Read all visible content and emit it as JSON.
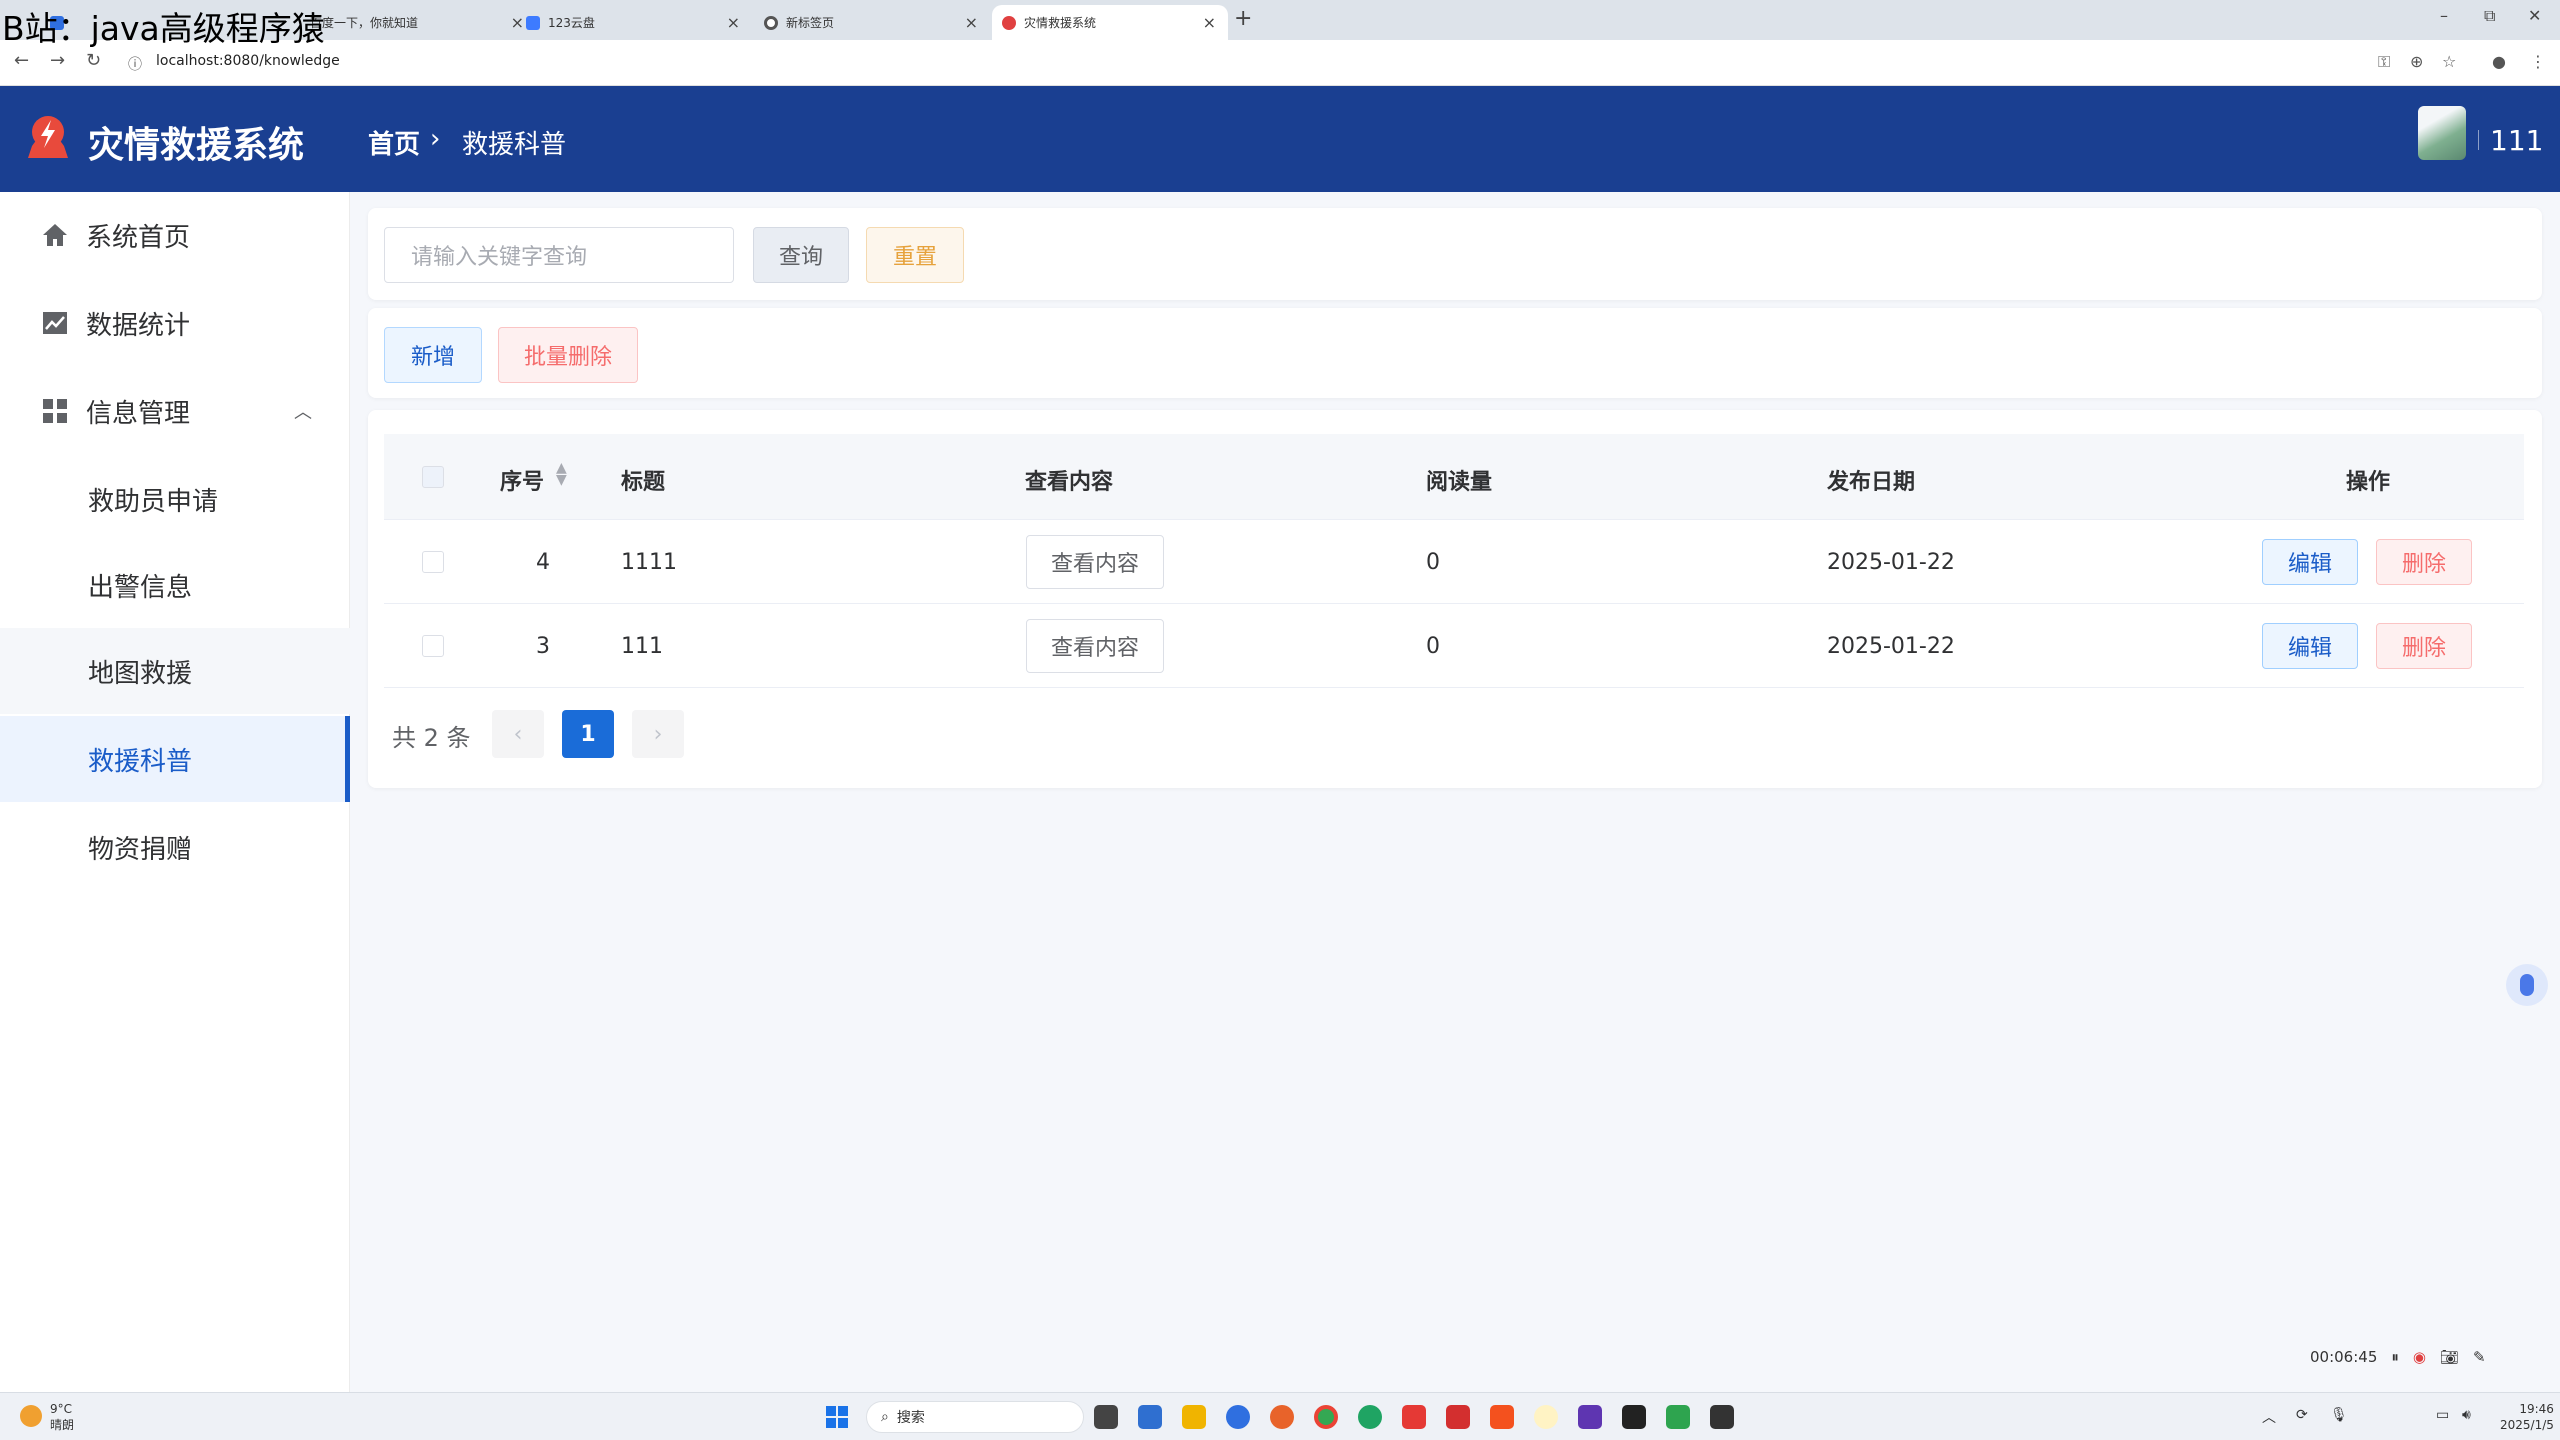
{
  "watermark": "B站：java高级程序猿",
  "browser": {
    "tabs": [
      {
        "title": "百度一下，你就知道",
        "active": false,
        "favicon": "baidu-icon",
        "color": "#2f6fe0"
      },
      {
        "title": "123云盘",
        "active": false,
        "favicon": "cloud-icon",
        "color": "#3d7bff"
      },
      {
        "title": "新标签页",
        "active": false,
        "favicon": "chrome-icon",
        "color": "#555555"
      },
      {
        "title": "灾情救援系统",
        "active": true,
        "favicon": "app-logo-icon",
        "color": "#e04040"
      }
    ],
    "url": "localhost:8080/knowledge"
  },
  "header": {
    "app_title": "灾情救援系统",
    "breadcrumb": {
      "home": "首页",
      "current": "救援科普"
    },
    "user_name": "111",
    "brand_color": "#1a3f91"
  },
  "sidebar": {
    "items": [
      {
        "label": "系统首页",
        "icon": "home-icon"
      },
      {
        "label": "数据统计",
        "icon": "chart-icon"
      },
      {
        "label": "信息管理",
        "icon": "grid-icon",
        "expanded": true
      }
    ],
    "sub_items": [
      {
        "label": "救助员申请"
      },
      {
        "label": "出警信息"
      },
      {
        "label": "地图救援"
      },
      {
        "label": "救援科普",
        "active": true
      },
      {
        "label": "物资捐赠"
      }
    ]
  },
  "search": {
    "placeholder": "请输入关键字查询",
    "query_label": "查询",
    "reset_label": "重置"
  },
  "toolbar": {
    "add_label": "新增",
    "batch_delete_label": "批量删除"
  },
  "table": {
    "headers": {
      "index": "序号",
      "title": "标题",
      "content": "查看内容",
      "reads": "阅读量",
      "date": "发布日期",
      "actions": "操作"
    },
    "rows": [
      {
        "index": "4",
        "title": "1111",
        "content_btn": "查看内容",
        "reads": "0",
        "date": "2025-01-22",
        "edit": "编辑",
        "delete": "删除"
      },
      {
        "index": "3",
        "title": "111",
        "content_btn": "查看内容",
        "reads": "0",
        "date": "2025-01-22",
        "edit": "编辑",
        "delete": "删除"
      }
    ]
  },
  "pagination": {
    "total_text": "共 2 条",
    "current_page": "1"
  },
  "recorder": {
    "time": "00:06:45"
  },
  "taskbar": {
    "search_label": "搜索",
    "weather_temp": "9°C",
    "weather_desc": "晴朗",
    "time": "19:46",
    "date": "2025/1/5"
  }
}
